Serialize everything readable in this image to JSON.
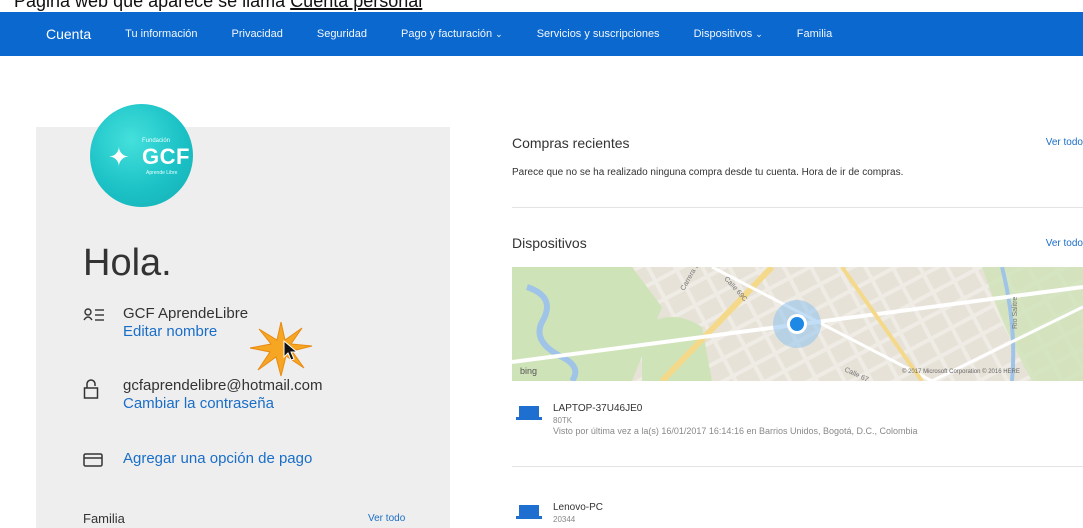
{
  "top_caption": {
    "visible_fragment": "Página web que aparece se llama ",
    "underlined_fragment": "Cuenta personal"
  },
  "navbar": {
    "brand": "Cuenta",
    "items": [
      {
        "label": "Tu información",
        "has_chevron": false
      },
      {
        "label": "Privacidad",
        "has_chevron": false
      },
      {
        "label": "Seguridad",
        "has_chevron": false
      },
      {
        "label": "Pago y facturación",
        "has_chevron": true
      },
      {
        "label": "Servicios y suscripciones",
        "has_chevron": false
      },
      {
        "label": "Dispositivos",
        "has_chevron": true
      },
      {
        "label": "Familia",
        "has_chevron": false
      }
    ],
    "chevron": "⌄"
  },
  "profile": {
    "logo": {
      "small_text": "Fundación",
      "big_text": "GCF",
      "sub_text": "Aprende Libre"
    },
    "greeting": "Hola.",
    "name": "GCF AprendeLibre",
    "edit_name_link": "Editar nombre",
    "email": "gcfaprendelibre@hotmail.com",
    "change_password_link": "Cambiar la contraseña",
    "add_payment_link": "Agregar una opción de pago",
    "family_label": "Familia",
    "family_link": "Ver todo"
  },
  "recent_purchases": {
    "title": "Compras recientes",
    "link": "Ver todo",
    "message": "Parece que no se ha realizado ninguna compra desde tu cuenta. Hora de ir de compras."
  },
  "devices": {
    "title": "Dispositivos",
    "link": "Ver todo",
    "map": {
      "streets": [
        "Calle 69C",
        "Carrera 56",
        "Calle 67",
        "Rio Salitre"
      ],
      "provider": "bing",
      "copyright": "© 2017 Microsoft Corporation  © 2016 HERE"
    },
    "list": [
      {
        "name": "LAPTOP-37U46JE0",
        "model": "80TK",
        "last_seen": "Visto por última vez a la(s) 16/01/2017 16:14:16 en Barrios Unidos, Bogotá, D.C., Colombia"
      },
      {
        "name": "Lenovo-PC",
        "model": "20344",
        "last_seen": ""
      }
    ]
  },
  "colors": {
    "navbar": "#0a68cf",
    "link": "#1a6ec8",
    "panel": "#eeeeee",
    "logo": "#1cc2c6"
  },
  "icons": {
    "name": "contact-card-icon",
    "password": "lock-icon",
    "payment": "credit-card-icon",
    "laptop": "laptop-icon",
    "pointer": "mouse-pointer-icon",
    "highlight": "click-burst-icon"
  }
}
